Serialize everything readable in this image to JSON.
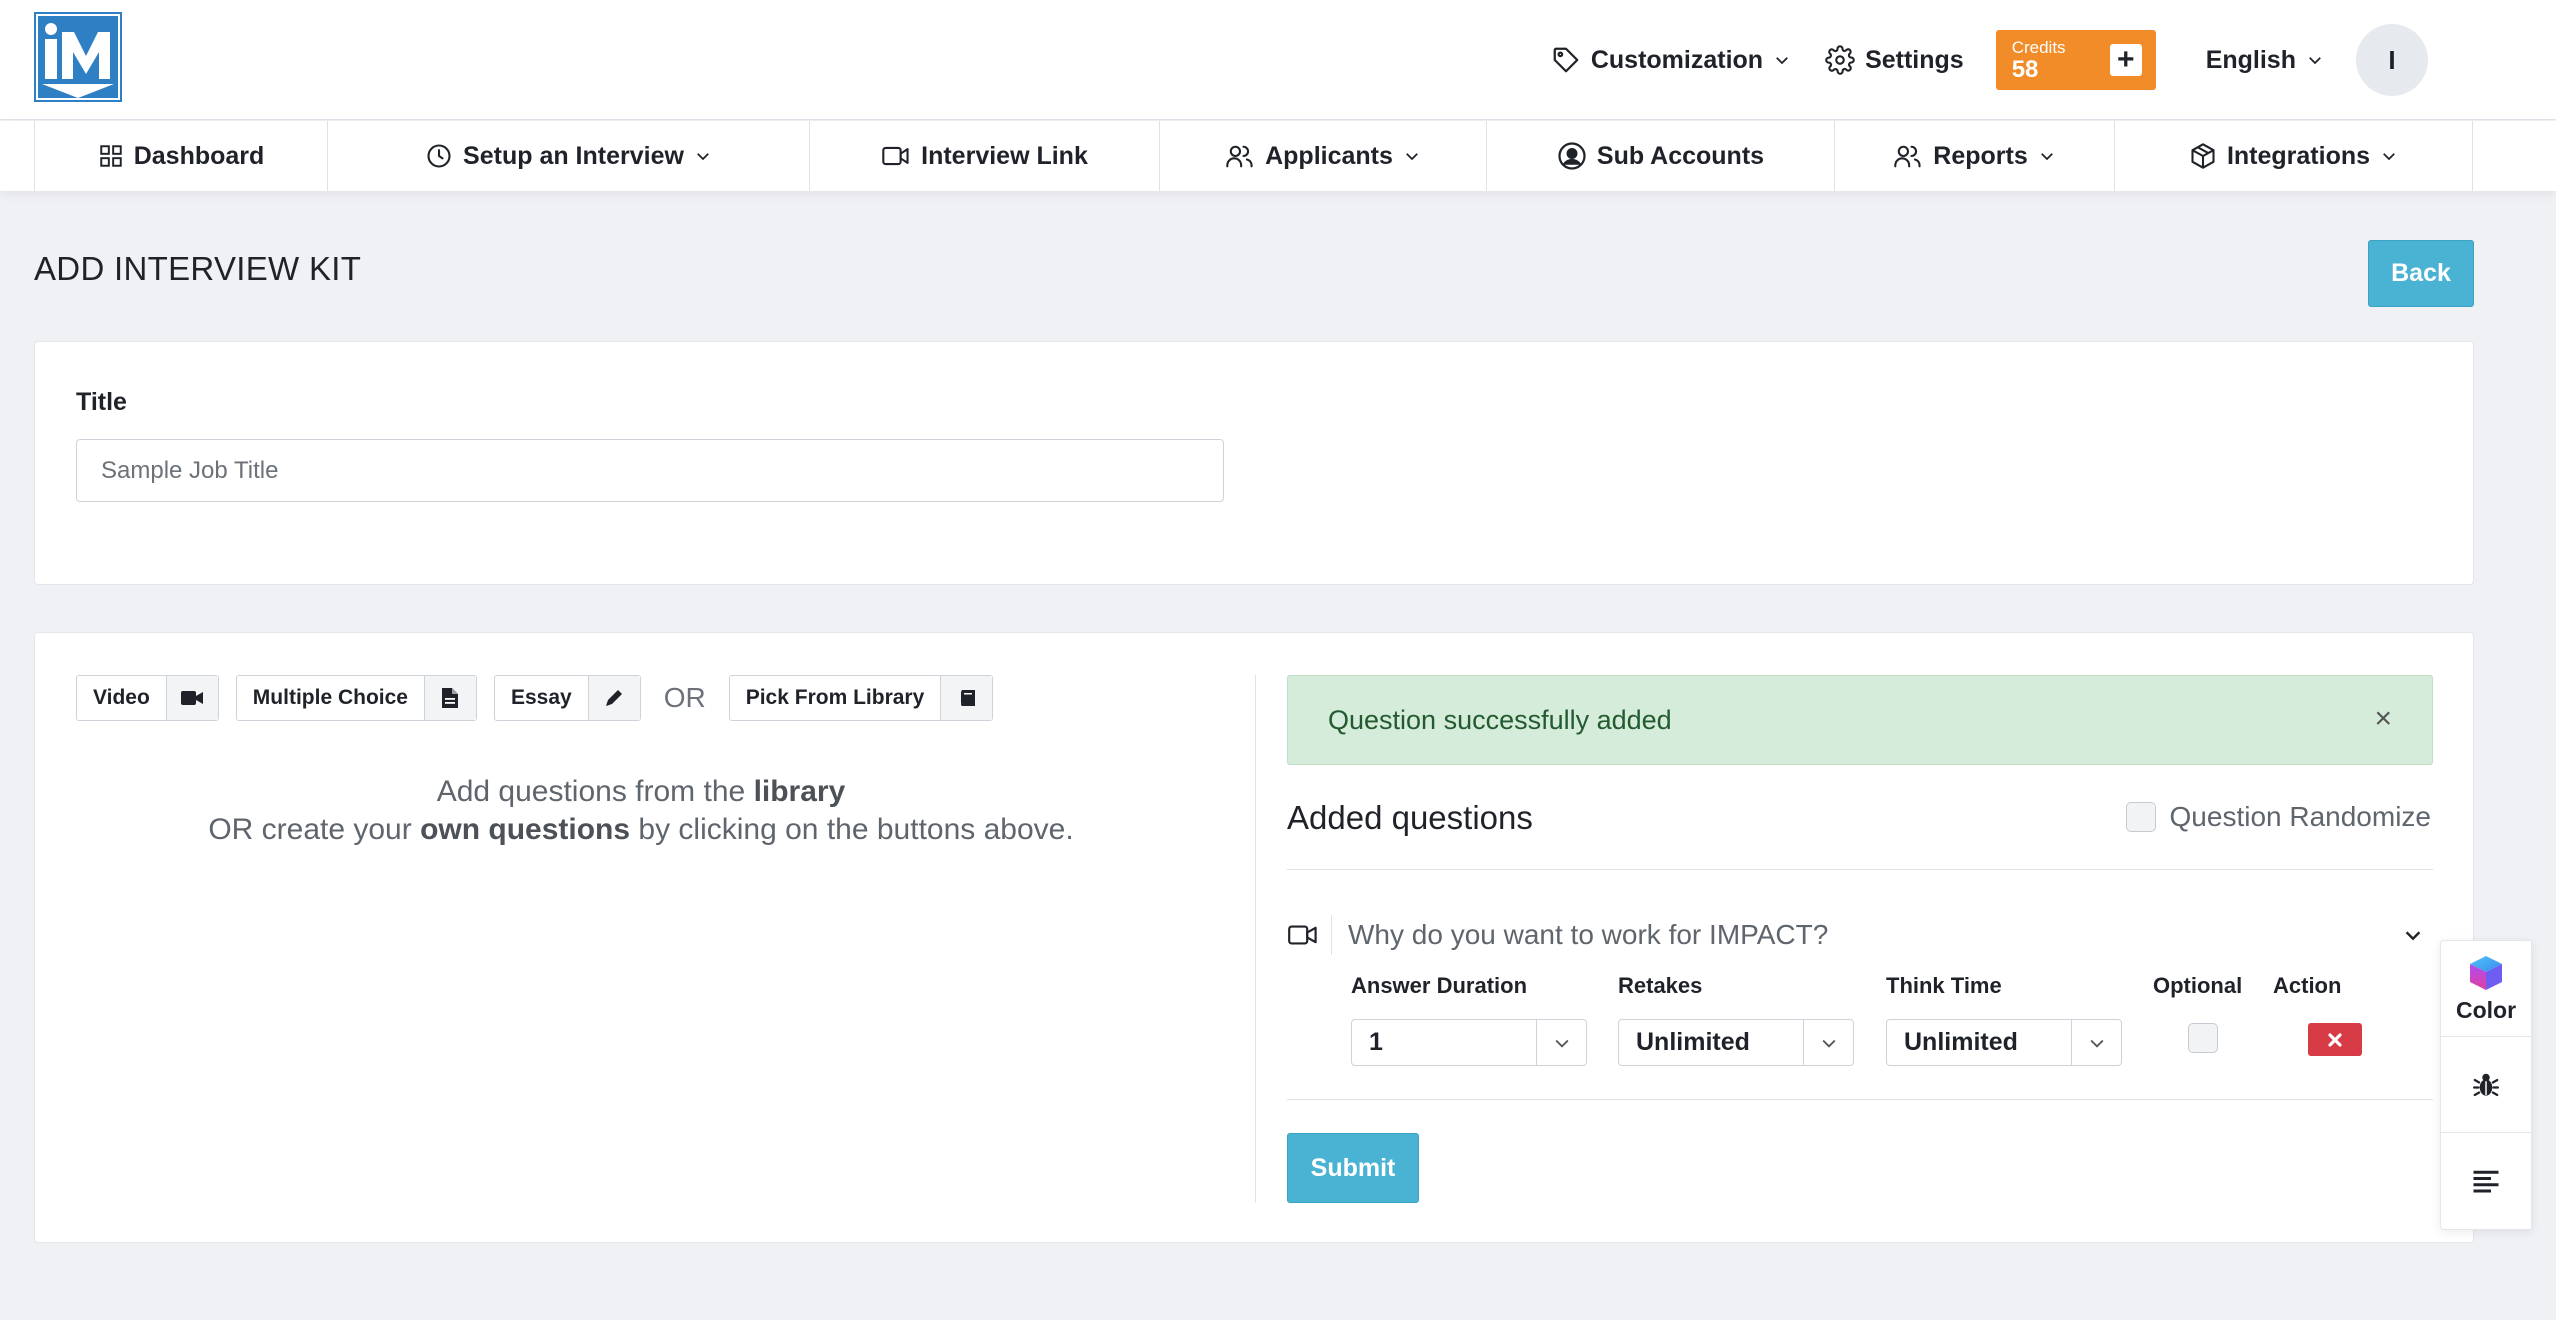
{
  "header": {
    "customization_label": "Customization",
    "settings_label": "Settings",
    "credits_label": "Credits",
    "credits_value": "58",
    "credits_add": "+",
    "language_label": "English",
    "avatar_initial": "I"
  },
  "nav": {
    "items": [
      {
        "label": "Dashboard"
      },
      {
        "label": "Setup an Interview"
      },
      {
        "label": "Interview Link"
      },
      {
        "label": "Applicants"
      },
      {
        "label": "Sub Accounts"
      },
      {
        "label": "Reports"
      },
      {
        "label": "Integrations"
      }
    ]
  },
  "page": {
    "title": "ADD INTERVIEW KIT",
    "back_label": "Back"
  },
  "title_card": {
    "label": "Title",
    "input_value": "",
    "input_placeholder": "Sample Job Title"
  },
  "question_types": {
    "video_label": "Video",
    "mc_label": "Multiple Choice",
    "essay_label": "Essay",
    "or_label": "OR",
    "library_label": "Pick From Library"
  },
  "hint": {
    "line1_prefix": "Add questions from the ",
    "line1_bold": "library",
    "line2_prefix": "OR create your ",
    "line2_bold": "own questions",
    "line2_suffix": " by clicking on the buttons above."
  },
  "alert": {
    "message": "Question successfully added",
    "close": "×"
  },
  "added": {
    "title": "Added questions",
    "randomize_label": "Question Randomize",
    "question": {
      "text": "Why do you want to work for IMPACT?",
      "answer_duration_label": "Answer Duration",
      "answer_duration_value": "1",
      "retakes_label": "Retakes",
      "retakes_value": "Unlimited",
      "think_time_label": "Think Time",
      "think_time_value": "Unlimited",
      "optional_label": "Optional",
      "action_label": "Action"
    },
    "submit_label": "Submit"
  },
  "widget": {
    "color_label": "Color"
  },
  "colors": {
    "accent": "#4ab3d4",
    "credits": "#f28c28",
    "logo_blue": "#2e7fc4",
    "danger": "#d63b46",
    "success_bg": "#d4ecd9"
  }
}
